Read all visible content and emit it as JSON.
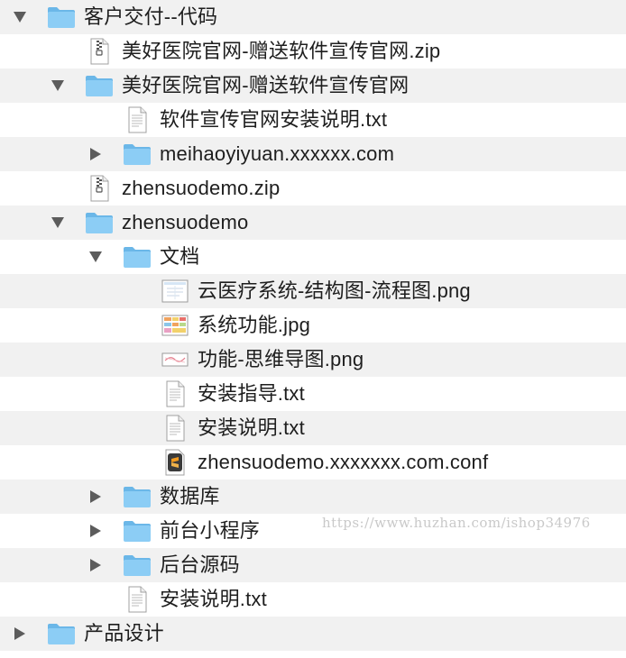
{
  "colors": {
    "folder": "#8ccdf5",
    "folder_tab": "#6bb7e8",
    "row_alt": "#f1f1f1",
    "text": "#1e1e1e",
    "disclosure": "#5c5c5c"
  },
  "rows": [
    {
      "name": "客户交付--代码",
      "type": "folder",
      "expanded": true
    },
    {
      "name": "美好医院官网-赠送软件宣传官网.zip",
      "type": "zip"
    },
    {
      "name": "美好医院官网-赠送软件宣传官网",
      "type": "folder",
      "expanded": true
    },
    {
      "name": "软件宣传官网安装说明.txt",
      "type": "text"
    },
    {
      "name": "meihaoyiyuan.xxxxxx.com",
      "type": "folder",
      "expanded": false
    },
    {
      "name": "zhensuodemo.zip",
      "type": "zip"
    },
    {
      "name": "zhensuodemo",
      "type": "folder",
      "expanded": true
    },
    {
      "name": "文档",
      "type": "folder",
      "expanded": true
    },
    {
      "name": "云医疗系统-结构图-流程图.png",
      "type": "image-diagram"
    },
    {
      "name": "系统功能.jpg",
      "type": "image-table"
    },
    {
      "name": "功能-思维导图.png",
      "type": "image-mindmap"
    },
    {
      "name": "安装指导.txt",
      "type": "text"
    },
    {
      "name": "安装说明.txt",
      "type": "text"
    },
    {
      "name": "zhensuodemo.xxxxxxx.com.conf",
      "type": "sublime-file"
    },
    {
      "name": "数据库",
      "type": "folder",
      "expanded": false
    },
    {
      "name": "前台小程序",
      "type": "folder",
      "expanded": false
    },
    {
      "name": "后台源码",
      "type": "folder",
      "expanded": false
    },
    {
      "name": "安装说明.txt",
      "type": "text"
    },
    {
      "name": "产品设计",
      "type": "folder",
      "expanded": false
    }
  ],
  "watermark": "https://www.huzhan.com/ishop34976"
}
